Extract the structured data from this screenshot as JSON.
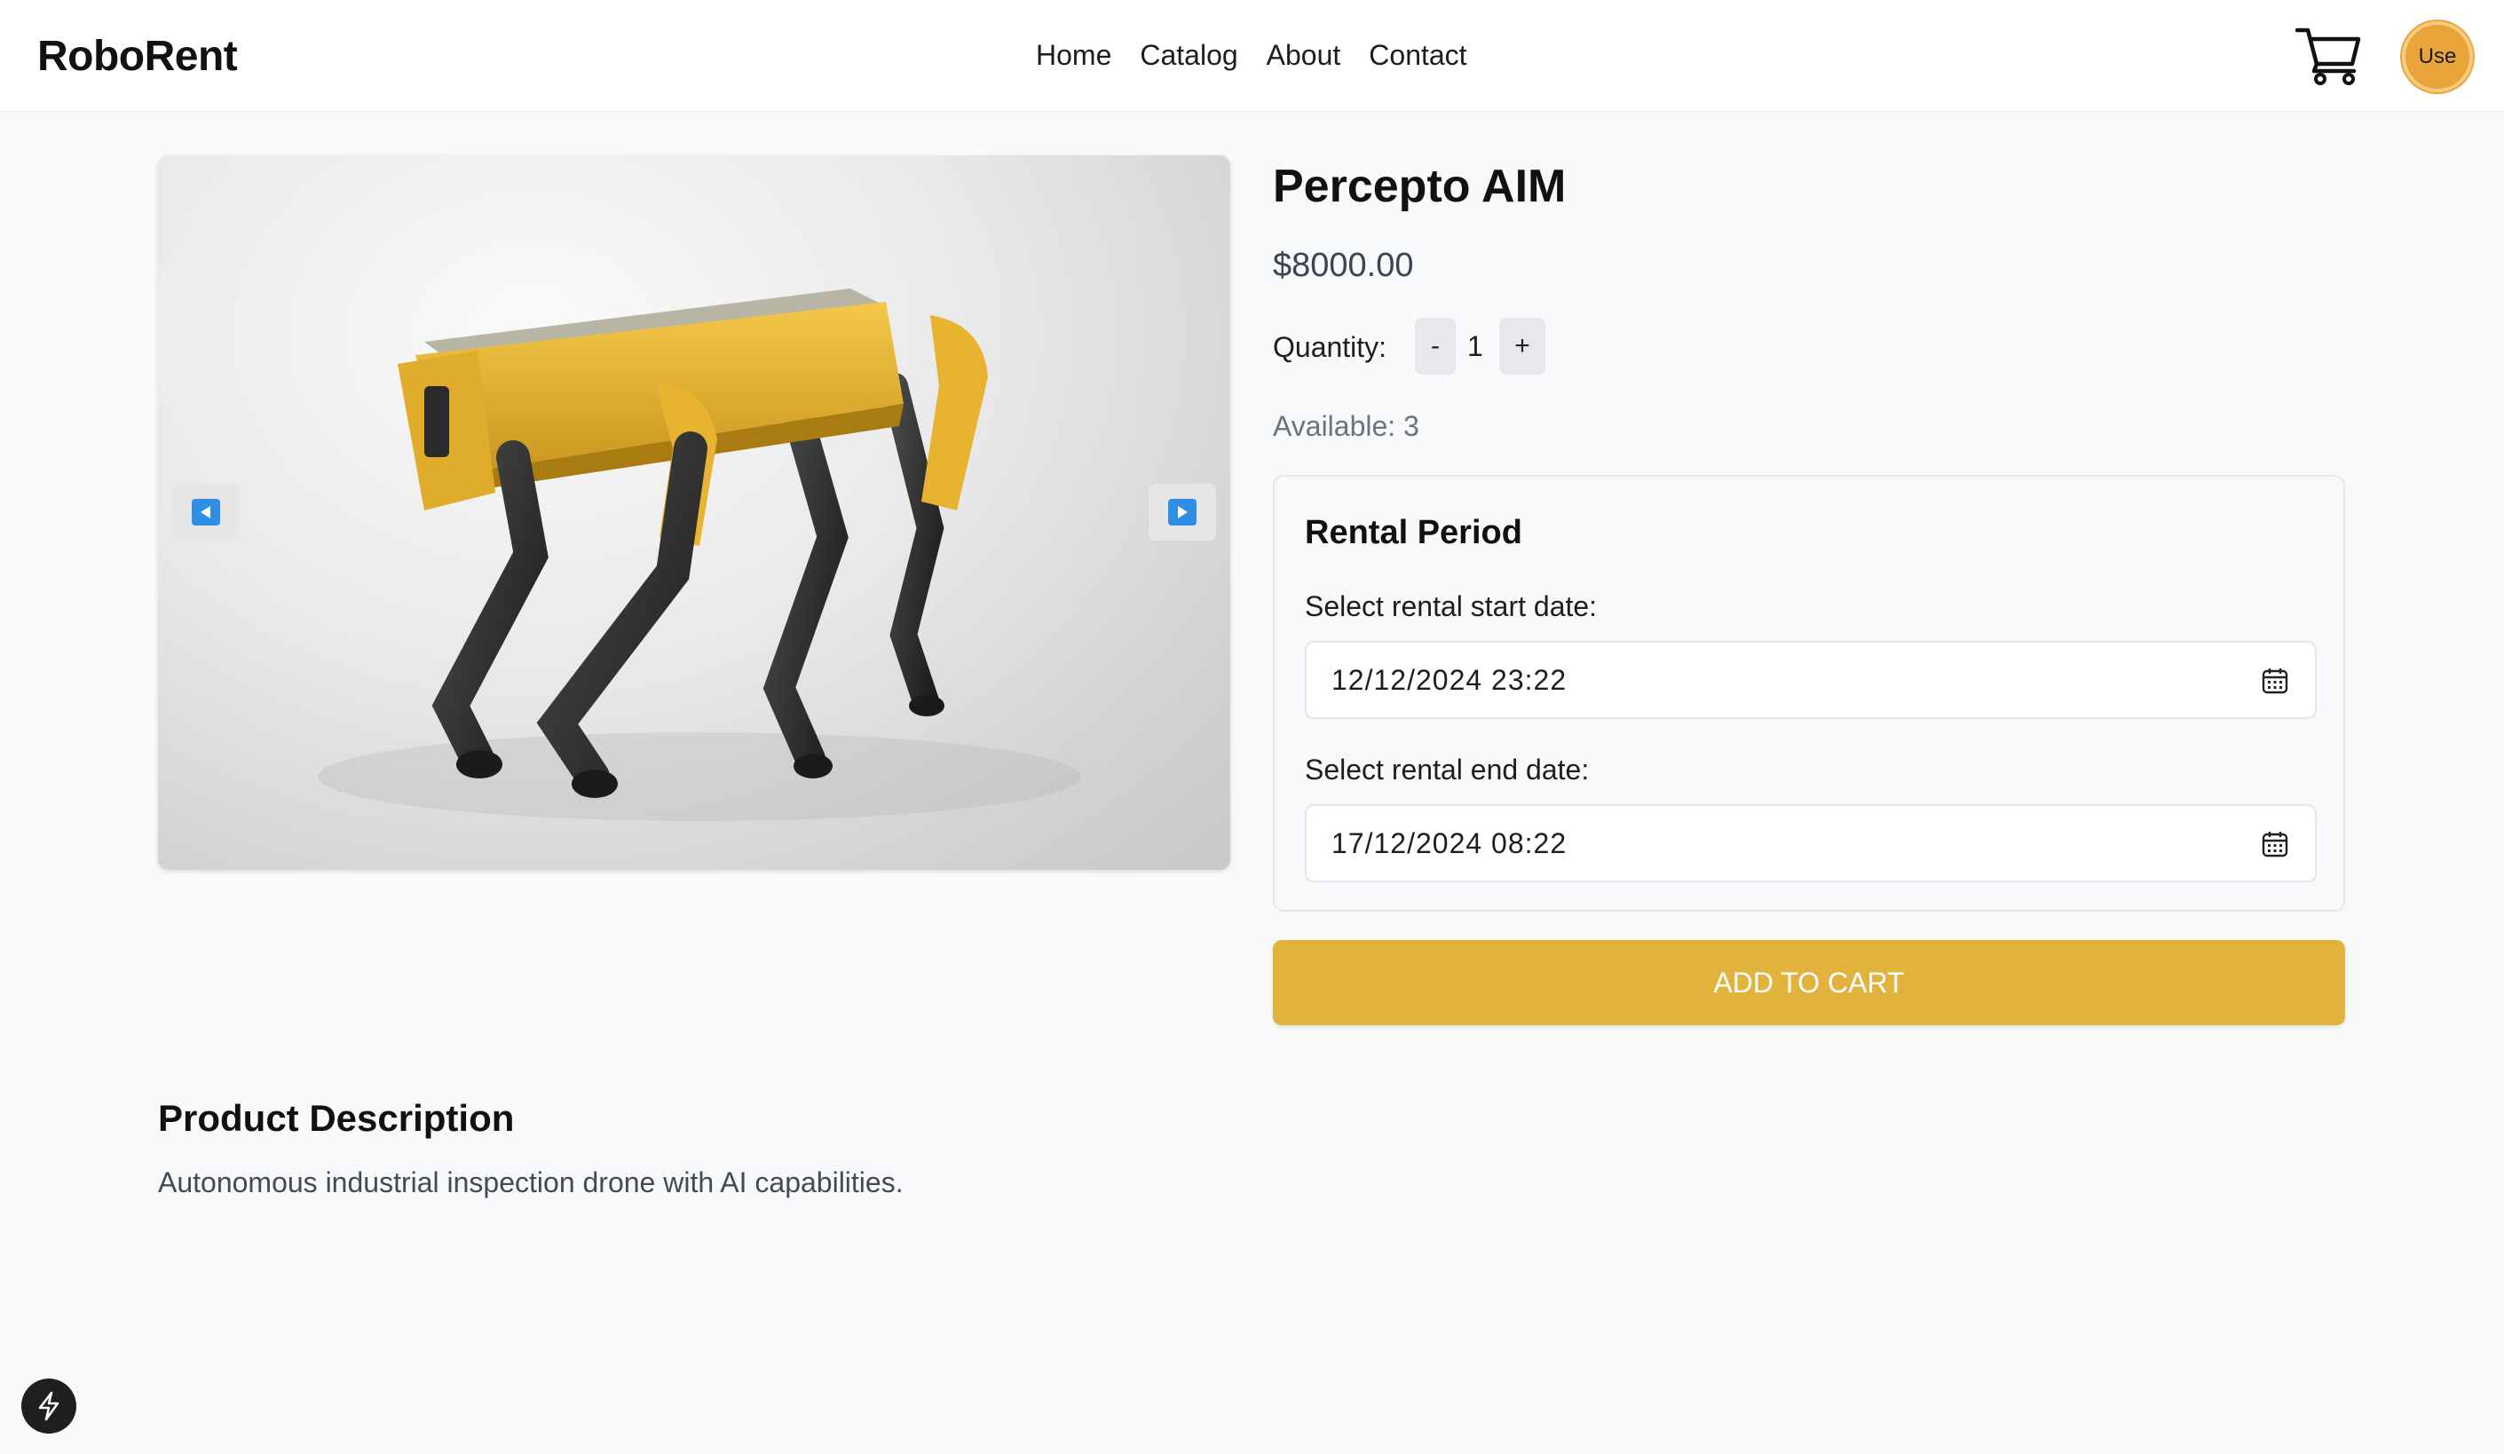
{
  "header": {
    "brand": "RoboRent",
    "nav": [
      "Home",
      "Catalog",
      "About",
      "Contact"
    ],
    "cart_icon": "shopping-cart-icon",
    "avatar_label": "Use"
  },
  "product": {
    "name": "Percepto AIM",
    "price": "$8000.00",
    "quantity_label": "Quantity:",
    "quantity_minus": "-",
    "quantity_value": "1",
    "quantity_plus": "+",
    "available": "Available: 3",
    "image_alt": "yellow quadruped robot",
    "gallery_prev_icon": "arrow-left-icon",
    "gallery_next_icon": "arrow-right-icon"
  },
  "rental": {
    "title": "Rental Period",
    "start_label": "Select rental start date:",
    "start_value": "12/12/2024 23:22",
    "end_label": "Select rental end date:",
    "end_value": "17/12/2024 08:22",
    "calendar_icon": "calendar-icon"
  },
  "add_to_cart_label": "ADD TO CART",
  "description": {
    "title": "Product Description",
    "text": "Autonomous industrial inspection drone with AI capabilities."
  },
  "floating_icon": "lightning-bolt-icon",
  "colors": {
    "accent": "#e2b33c",
    "avatar": "#e9a43a",
    "gallery_button": "#2f8fe6",
    "background": "#f8f9fb"
  }
}
